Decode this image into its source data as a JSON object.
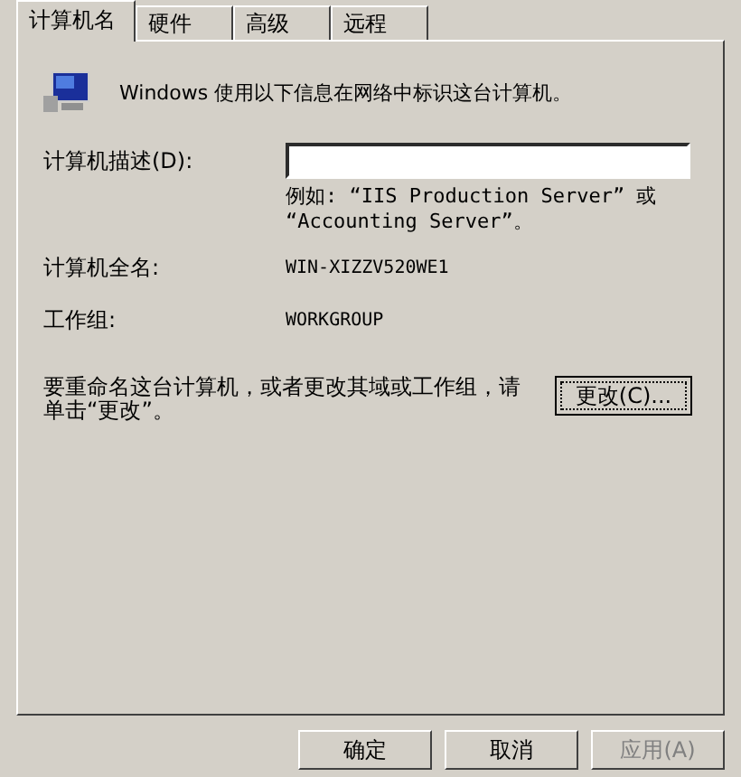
{
  "tabs": [
    {
      "label": "计算机名",
      "selected": true
    },
    {
      "label": "硬件",
      "selected": false
    },
    {
      "label": "高级",
      "selected": false
    },
    {
      "label": "远程",
      "selected": false
    }
  ],
  "intro": "Windows 使用以下信息在网络中标识这台计算机。",
  "description": {
    "label": "计算机描述(D):",
    "example": "例如: “IIS Production Server” 或 “Accounting Server”。"
  },
  "fields": [
    {
      "label": "计算机全名:",
      "value": "WIN-XIZZV520WE1"
    },
    {
      "label": "工作组:",
      "value": "WORKGROUP"
    }
  ],
  "rename": {
    "text": "要重命名这台计算机，或者更改其域或工作组，请单击“更改”。",
    "button": "更改(C)..."
  },
  "buttons": [
    {
      "label": "确定",
      "disabled": false
    },
    {
      "label": "取消",
      "disabled": false
    },
    {
      "label": "应用(A)",
      "disabled": true
    }
  ]
}
